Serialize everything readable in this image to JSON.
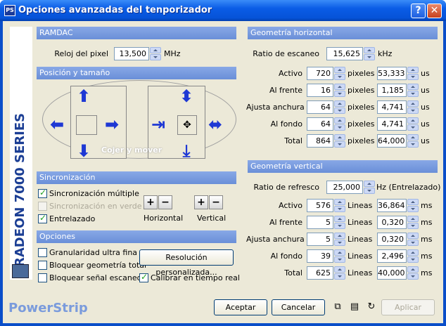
{
  "window": {
    "title": "Opciones avanzadas del tenporizador",
    "help": "?",
    "close": "✕"
  },
  "sidebar": {
    "text": "RADEON 7000 SERIES"
  },
  "ramdac": {
    "header": "RAMDAC",
    "clock_label": "Reloj del pixel",
    "clock_value": "13,500",
    "clock_unit": "MHz"
  },
  "pos": {
    "header": "Posición y tamaño",
    "move_label": "Cojer y mover"
  },
  "sync": {
    "header": "Sincronización",
    "multi": "Sincronización múltiple",
    "green": "Sincronización en verde",
    "interlace": "Entrelazado",
    "horiz": "Horizontal",
    "vert": "Vertical"
  },
  "options": {
    "header": "Opciones",
    "granular": "Granularidad ultra fina",
    "lockgeo": "Bloquear geometría total",
    "lockscan": "Bloquear señal escaneo",
    "custom_res": "Resolución personalizada...",
    "calib": "Calibrar en tiempo real"
  },
  "hgeo": {
    "header": "Geometría horizontal",
    "scan_label": "Ratio de escaneo",
    "scan_value": "15,625",
    "scan_unit": "kHz",
    "rows": [
      {
        "label": "Activo",
        "val": "720",
        "u1": "pixeles",
        "us": "53,333",
        "u2": "us"
      },
      {
        "label": "Al frente",
        "val": "16",
        "u1": "pixeles",
        "us": "1,185",
        "u2": "us"
      },
      {
        "label": "Ajusta anchura",
        "val": "64",
        "u1": "pixeles",
        "us": "4,741",
        "u2": "us"
      },
      {
        "label": "Al fondo",
        "val": "64",
        "u1": "pixeles",
        "us": "4,741",
        "u2": "us"
      },
      {
        "label": "Total",
        "val": "864",
        "u1": "pixeles",
        "us": "64,000",
        "u2": "us"
      }
    ]
  },
  "vgeo": {
    "header": "Geometría vertical",
    "rate_label": "Ratio de refresco",
    "rate_value": "25,000",
    "rate_unit": "Hz (Entrelazado)",
    "rows": [
      {
        "label": "Activo",
        "val": "576",
        "u1": "Lineas",
        "ms": "36,864",
        "u2": "ms"
      },
      {
        "label": "Al frente",
        "val": "5",
        "u1": "Lineas",
        "ms": "0,320",
        "u2": "ms"
      },
      {
        "label": "Ajusta anchura",
        "val": "5",
        "u1": "Lineas",
        "ms": "0,320",
        "u2": "ms"
      },
      {
        "label": "Al fondo",
        "val": "39",
        "u1": "Lineas",
        "ms": "2,496",
        "u2": "ms"
      },
      {
        "label": "Total",
        "val": "625",
        "u1": "Lineas",
        "ms": "40,000",
        "u2": "ms"
      }
    ]
  },
  "footer": {
    "brand": "PowerStrip",
    "accept": "Aceptar",
    "cancel": "Cancelar",
    "apply": "Aplicar"
  }
}
